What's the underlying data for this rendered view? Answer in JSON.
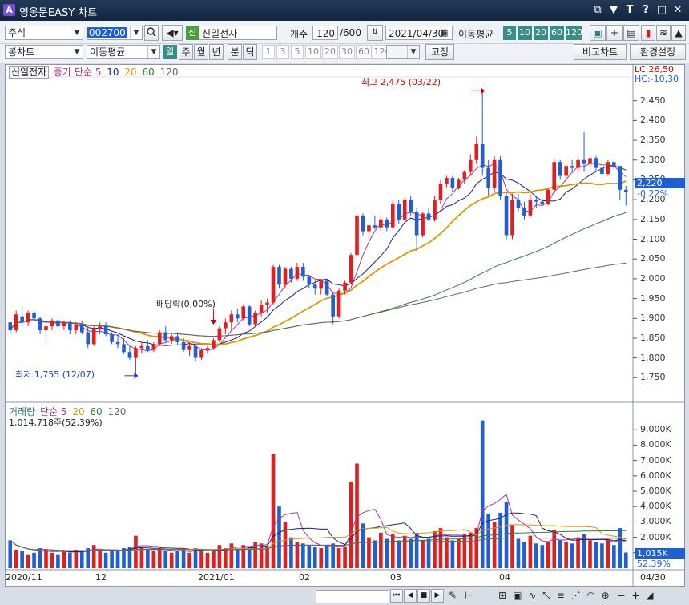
{
  "window": {
    "title": "영웅문EASY 차트",
    "app_icon": "A"
  },
  "toolbar1": {
    "market_select": "주식",
    "code_input": "002700",
    "stock_badge": "신",
    "stock_name": "신일전자",
    "count_label": "개수",
    "count_value": "120",
    "count_max": "/600",
    "date_value": "2021/04/30",
    "ma_label": "이동평균",
    "ma_periods": [
      "5",
      "10",
      "20",
      "60",
      "120"
    ]
  },
  "toolbar2": {
    "chart_type": "봉차트",
    "indicator": "이동평균",
    "period_tabs": [
      "일",
      "주",
      "월",
      "년",
      "분",
      "틱"
    ],
    "minute_options": [
      "1",
      "3",
      "5",
      "10",
      "20",
      "30",
      "60",
      "120"
    ],
    "fix_button": "고정",
    "compare_button": "비교차트",
    "settings_button": "환경설정"
  },
  "price_panel": {
    "stock_tag": "신일전자",
    "legend": [
      {
        "label": "종가 단순",
        "color": "#b0319c"
      },
      {
        "label": "5",
        "color": "#b0319c"
      },
      {
        "label": "10",
        "color": "#1a237e"
      },
      {
        "label": "20",
        "color": "#d99a00"
      },
      {
        "label": "60",
        "color": "#2e7d32"
      },
      {
        "label": "120",
        "color": "#666666"
      }
    ],
    "lc": "LC:26,50",
    "hc": "HC:-10,30",
    "current_price": "2,220",
    "change_pct": "-0.22%",
    "y_ticks": [
      "2,450",
      "2,400",
      "2,350",
      "2,300",
      "2,250",
      "2,200",
      "2,150",
      "2,100",
      "2,050",
      "2,000",
      "1,950",
      "1,900",
      "1,850",
      "1,800",
      "1,750"
    ],
    "high_annotation": "최고 2,475 (03/22)",
    "low_annotation": "최저 1,755 (12/07)",
    "dividend_annotation": "배당락(0,00%)"
  },
  "volume_panel": {
    "title": "거래량",
    "legend": [
      {
        "label": "단순 5",
        "color": "#b0319c"
      },
      {
        "label": "20",
        "color": "#d99a00"
      },
      {
        "label": "60",
        "color": "#2e7d32"
      },
      {
        "label": "120",
        "color": "#666666"
      }
    ],
    "volume_text": "1,014,718주(52,39%)",
    "y_ticks": [
      "9,000K",
      "8,000K",
      "7,000K",
      "6,000K",
      "5,000K",
      "4,000K",
      "3,000K",
      "2,000K",
      "1,000K"
    ],
    "current_volume": "1,015K",
    "current_ratio": "52,39%"
  },
  "x_axis": {
    "labels": [
      "2020/11",
      "12",
      "2021/01",
      "02",
      "03",
      "04"
    ],
    "end_label": "04/30"
  },
  "colors": {
    "up": "#e02020",
    "down": "#1f5fd6",
    "ma5": "#b0319c",
    "ma10": "#1a237e",
    "ma20": "#d99a00",
    "ma60": "#2e7d32",
    "ma120": "#666666"
  },
  "chart_data": {
    "type": "candlestick",
    "xlabel": "",
    "ylabel": "",
    "ylim": [
      1700,
      2500
    ],
    "volume_ylim": [
      0,
      10000
    ],
    "volume_unit": "K",
    "candles": [
      [
        1890,
        1890,
        1860,
        1870
      ],
      [
        1870,
        1920,
        1865,
        1910
      ],
      [
        1905,
        1930,
        1880,
        1890
      ],
      [
        1890,
        1920,
        1880,
        1915
      ],
      [
        1915,
        1925,
        1895,
        1900
      ],
      [
        1900,
        1905,
        1860,
        1870
      ],
      [
        1870,
        1890,
        1840,
        1880
      ],
      [
        1880,
        1900,
        1870,
        1895
      ],
      [
        1895,
        1900,
        1875,
        1880
      ],
      [
        1880,
        1895,
        1870,
        1890
      ],
      [
        1890,
        1895,
        1860,
        1870
      ],
      [
        1870,
        1890,
        1860,
        1885
      ],
      [
        1885,
        1895,
        1860,
        1865
      ],
      [
        1865,
        1880,
        1825,
        1835
      ],
      [
        1835,
        1880,
        1830,
        1875
      ],
      [
        1875,
        1890,
        1860,
        1880
      ],
      [
        1880,
        1890,
        1855,
        1860
      ],
      [
        1860,
        1865,
        1835,
        1840
      ],
      [
        1840,
        1860,
        1825,
        1835
      ],
      [
        1835,
        1850,
        1810,
        1815
      ],
      [
        1815,
        1830,
        1795,
        1800
      ],
      [
        1800,
        1830,
        1755,
        1825
      ],
      [
        1825,
        1840,
        1810,
        1830
      ],
      [
        1830,
        1845,
        1815,
        1820
      ],
      [
        1820,
        1840,
        1815,
        1835
      ],
      [
        1835,
        1870,
        1830,
        1865
      ],
      [
        1865,
        1880,
        1840,
        1845
      ],
      [
        1845,
        1860,
        1835,
        1855
      ],
      [
        1855,
        1865,
        1835,
        1840
      ],
      [
        1840,
        1850,
        1815,
        1820
      ],
      [
        1820,
        1840,
        1805,
        1830
      ],
      [
        1830,
        1835,
        1790,
        1800
      ],
      [
        1800,
        1825,
        1795,
        1820
      ],
      [
        1820,
        1830,
        1810,
        1825
      ],
      [
        1825,
        1850,
        1820,
        1845
      ],
      [
        1845,
        1880,
        1840,
        1875
      ],
      [
        1875,
        1900,
        1860,
        1890
      ],
      [
        1890,
        1920,
        1870,
        1910
      ],
      [
        1910,
        1925,
        1890,
        1900
      ],
      [
        1900,
        1935,
        1895,
        1930
      ],
      [
        1930,
        1935,
        1880,
        1885
      ],
      [
        1885,
        1920,
        1880,
        1915
      ],
      [
        1915,
        1945,
        1905,
        1935
      ],
      [
        1935,
        1950,
        1915,
        1940
      ],
      [
        1940,
        2035,
        1935,
        2030
      ],
      [
        2030,
        2035,
        1975,
        1985
      ],
      [
        1985,
        2030,
        1975,
        2025
      ],
      [
        2025,
        2030,
        1990,
        2000
      ],
      [
        2000,
        2040,
        1995,
        2030
      ],
      [
        2030,
        2040,
        1995,
        2005
      ],
      [
        2005,
        2010,
        1975,
        1985
      ],
      [
        1985,
        1995,
        1960,
        1975
      ],
      [
        1975,
        2000,
        1960,
        1995
      ],
      [
        1995,
        2000,
        1955,
        1960
      ],
      [
        1960,
        1965,
        1885,
        1905
      ],
      [
        1905,
        1975,
        1900,
        1970
      ],
      [
        1970,
        1995,
        1960,
        1990
      ],
      [
        1990,
        2065,
        1985,
        2060
      ],
      [
        2060,
        2170,
        2050,
        2160
      ],
      [
        2160,
        2165,
        2110,
        2120
      ],
      [
        2120,
        2140,
        2100,
        2135
      ],
      [
        2135,
        2160,
        2125,
        2130
      ],
      [
        2130,
        2160,
        2120,
        2150
      ],
      [
        2150,
        2155,
        2120,
        2130
      ],
      [
        2130,
        2200,
        2125,
        2190
      ],
      [
        2190,
        2200,
        2140,
        2150
      ],
      [
        2150,
        2205,
        2145,
        2200
      ],
      [
        2200,
        2210,
        2160,
        2170
      ],
      [
        2170,
        2180,
        2070,
        2110
      ],
      [
        2110,
        2170,
        2105,
        2165
      ],
      [
        2165,
        2180,
        2145,
        2150
      ],
      [
        2150,
        2210,
        2145,
        2200
      ],
      [
        2200,
        2250,
        2190,
        2240
      ],
      [
        2240,
        2260,
        2230,
        2255
      ],
      [
        2255,
        2260,
        2220,
        2230
      ],
      [
        2230,
        2255,
        2225,
        2250
      ],
      [
        2250,
        2275,
        2240,
        2270
      ],
      [
        2270,
        2315,
        2260,
        2300
      ],
      [
        2300,
        2360,
        2290,
        2340
      ],
      [
        2340,
        2475,
        2260,
        2280
      ],
      [
        2280,
        2300,
        2210,
        2230
      ],
      [
        2230,
        2310,
        2220,
        2300
      ],
      [
        2300,
        2310,
        2200,
        2210
      ],
      [
        2210,
        2215,
        2100,
        2110
      ],
      [
        2110,
        2215,
        2100,
        2200
      ],
      [
        2200,
        2215,
        2170,
        2180
      ],
      [
        2180,
        2195,
        2150,
        2160
      ],
      [
        2160,
        2215,
        2155,
        2200
      ],
      [
        2200,
        2210,
        2180,
        2195
      ],
      [
        2195,
        2205,
        2185,
        2190
      ],
      [
        2190,
        2230,
        2185,
        2225
      ],
      [
        2225,
        2305,
        2215,
        2295
      ],
      [
        2295,
        2300,
        2250,
        2260
      ],
      [
        2260,
        2290,
        2250,
        2285
      ],
      [
        2285,
        2300,
        2270,
        2280
      ],
      [
        2280,
        2310,
        2260,
        2300
      ],
      [
        2300,
        2370,
        2270,
        2290
      ],
      [
        2290,
        2310,
        2280,
        2305
      ],
      [
        2305,
        2310,
        2270,
        2280
      ],
      [
        2280,
        2295,
        2260,
        2265
      ],
      [
        2265,
        2300,
        2260,
        2295
      ],
      [
        2295,
        2300,
        2275,
        2285
      ],
      [
        2285,
        2270,
        2200,
        2225
      ],
      [
        2225,
        2235,
        2185,
        2220
      ]
    ],
    "volumes": [
      1800,
      1200,
      1100,
      900,
      1000,
      1300,
      1200,
      1000,
      900,
      1100,
      1000,
      1200,
      1100,
      1300,
      1500,
      1100,
      1000,
      1100,
      1200,
      1300,
      1400,
      2100,
      1300,
      1200,
      1100,
      1300,
      1100,
      1000,
      1100,
      1200,
      1000,
      1300,
      1100,
      1000,
      1200,
      1500,
      1300,
      1600,
      1200,
      1500,
      1400,
      1700,
      1600,
      1400,
      7400,
      4000,
      3000,
      2000,
      1700,
      1600,
      1500,
      1400,
      1300,
      1500,
      1600,
      1300,
      1400,
      5600,
      6800,
      2900,
      2000,
      1800,
      2300,
      1900,
      2200,
      1800,
      2100,
      1900,
      2300,
      1800,
      1900,
      2400,
      2600,
      2000,
      1800,
      1900,
      2200,
      2300,
      2600,
      9600,
      3500,
      3000,
      3600,
      4300,
      2800,
      1900,
      1700,
      2100,
      1600,
      1500,
      1700,
      2500,
      1800,
      1700,
      1600,
      2000,
      2200,
      1800,
      1700,
      1600,
      1800,
      1500,
      2600,
      1015
    ],
    "ma_periods": [
      5,
      10,
      20,
      60,
      120
    ]
  }
}
